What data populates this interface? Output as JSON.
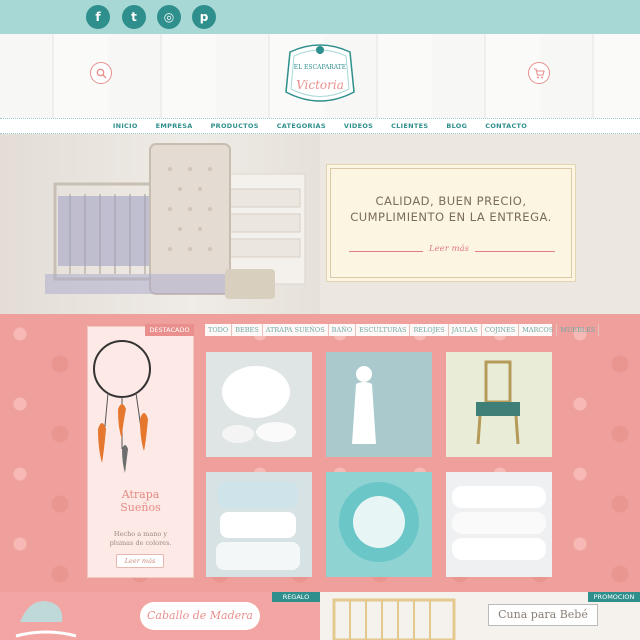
{
  "social": [
    {
      "name": "facebook",
      "glyph": "f"
    },
    {
      "name": "twitter",
      "glyph": "t"
    },
    {
      "name": "instagram",
      "glyph": "◎"
    },
    {
      "name": "pinterest",
      "glyph": "p"
    }
  ],
  "logo": {
    "line1": "EL ESCAPARATE",
    "line2": "Victoria"
  },
  "nav": [
    "INICIO",
    "EMPRESA",
    "PRODUCTOS",
    "CATEGORIAS",
    "VIDEOS",
    "CLIENTES",
    "BLOG",
    "CONTACTO"
  ],
  "hero": {
    "message": "CALIDAD, BUEN PRECIO,\nCUMPLIMIENTO EN LA ENTREGA.",
    "link": "Leer más"
  },
  "featured": {
    "label": "DESTACADO",
    "title": "Atrapa\nSueños",
    "subtitle": "Hecho a mano y\nplumas de colores.",
    "button": "Leer más"
  },
  "filters": [
    "TODO",
    "BEBES",
    "ATRAPA SUEÑOS",
    "BAÑO",
    "ESCULTURAS",
    "RELOJES",
    "JAULAS",
    "COJINES",
    "MARCOS",
    "MUEBLES"
  ],
  "promos": {
    "left": {
      "tag": "REGALO",
      "title": "Caballo de Madera"
    },
    "right": {
      "tag": "PROMOCION",
      "title": "Cuna para Bebé"
    }
  },
  "colors": {
    "teal": "#2f8f8c",
    "pink": "#e98f8d",
    "mint": "#a8d8d6"
  }
}
